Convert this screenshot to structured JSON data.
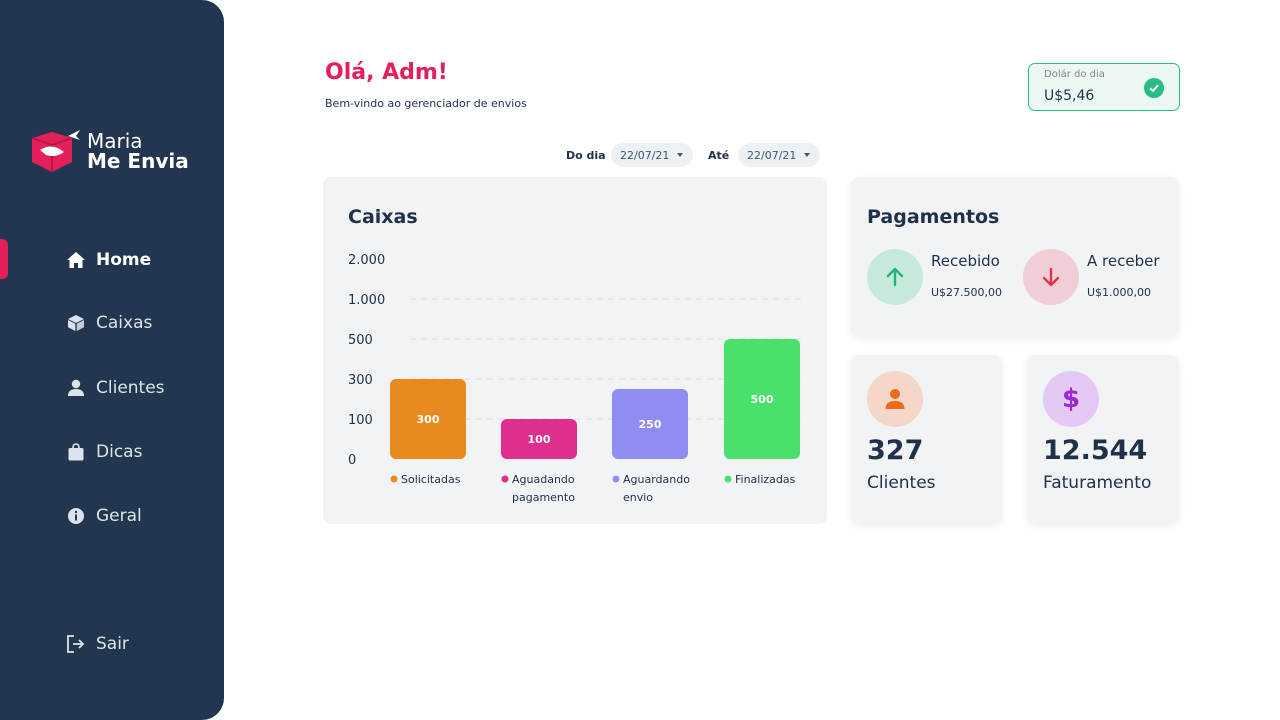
{
  "brand": {
    "line1": "Maria",
    "line2": "Me Envia",
    "color": "#e3205a"
  },
  "sidebar": {
    "items": [
      {
        "label": "Home",
        "icon": "home-icon",
        "active": true
      },
      {
        "label": "Caixas",
        "icon": "box-icon",
        "active": false
      },
      {
        "label": "Clientes",
        "icon": "user-icon",
        "active": false
      },
      {
        "label": "Dicas",
        "icon": "bag-icon",
        "active": false
      },
      {
        "label": "Geral",
        "icon": "info-icon",
        "active": false
      }
    ],
    "logout": {
      "label": "Sair",
      "icon": "logout-icon"
    }
  },
  "header": {
    "greeting": "Olá, Adm!",
    "subtitle": "Bem-vindo ao gerenciador de envios"
  },
  "dolar": {
    "label": "Dolár do dia",
    "value": "U$5,46",
    "icon": "check-circle-icon"
  },
  "filters": {
    "from_label": "Do dia",
    "from_value": "22/07/21",
    "to_label": "Até",
    "to_value": "22/07/21"
  },
  "caixas": {
    "title": "Caixas"
  },
  "chart_data": {
    "type": "bar",
    "title": "Caixas",
    "y_ticks": [
      "2.000",
      "1.000",
      "500",
      "300",
      "100",
      "0"
    ],
    "categories": [
      "Solicitadas",
      "Aguadando pagamento",
      "Aguardando envio",
      "Finalizadas"
    ],
    "category_lines": [
      [
        "Solicitadas"
      ],
      [
        "Aguadando",
        "pagamento"
      ],
      [
        "Aguardando",
        "envio"
      ],
      [
        "Finalizadas"
      ]
    ],
    "values": [
      300,
      100,
      250,
      500
    ],
    "value_labels": [
      "300",
      "100",
      "250",
      "500"
    ],
    "colors": [
      "#ea8a1e",
      "#de2f8e",
      "#8f8cf2",
      "#49e06c"
    ],
    "y_scale": "piecewise",
    "grid": true,
    "legend": "below"
  },
  "pagamentos": {
    "title": "Pagamentos",
    "received": {
      "label": "Recebido",
      "value": "U$27.500,00",
      "icon": "arrow-up-icon",
      "color": "#23b47a"
    },
    "pending": {
      "label": "A receber",
      "value": "U$1.000,00",
      "icon": "arrow-down-icon",
      "color": "#e0334f"
    }
  },
  "clientes": {
    "number": "327",
    "label": "Clientes",
    "icon": "user-icon",
    "color": "#ec6a1a"
  },
  "faturamento": {
    "number": "12.544",
    "label": "Faturamento",
    "icon": "dollar-icon",
    "color": "#9b27d6"
  }
}
